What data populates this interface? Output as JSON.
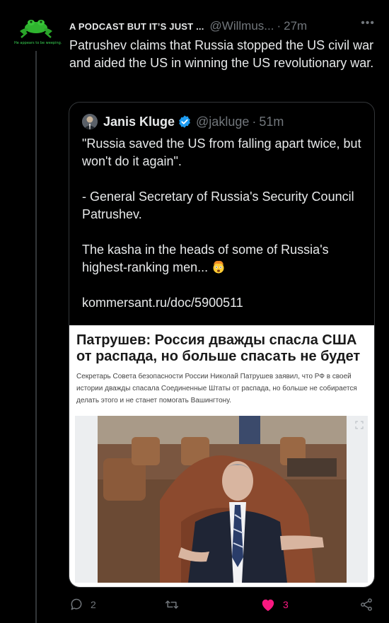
{
  "author": {
    "display_name": "A PODCAST BUT IT’S JUST ...",
    "handle": "@Willmus...",
    "time": "27m",
    "avatar_tagline": "He appears to be weeping.",
    "avatar_icon": "green-frog-logo"
  },
  "tweet": {
    "text": "Patrushev claims that Russia stopped the US civil war and aided the US in winning the US revolutionary war."
  },
  "quote": {
    "display_name": "Janis Kluge",
    "handle": "@jakluge",
    "time": "51m",
    "verified_color": "#1d9bf0",
    "paragraph_1": "\"Russia saved the US from falling apart twice, but won't do it again\".",
    "paragraph_2": "- General Secretary of Russia's Security Council Patrushev.",
    "paragraph_3": "The kasha in the heads of some of Russia's highest-ranking men...",
    "emoji": "exploding-head",
    "link": "kommersant.ru/doc/5900511",
    "article": {
      "title": "Патрушев: Россия дважды спасла США от распада, но больше спасать не будет",
      "lead": "Секретарь Совета безопасности России Николай Патрушев заявил, что РФ в своей истории дважды спасала Соединенные Штаты от распада, но больше не собирается делать этого и не станет помогать Вашингтону."
    }
  },
  "actions": {
    "replies": "2",
    "retweets": "",
    "likes": "3",
    "like_color": "#f91880"
  }
}
